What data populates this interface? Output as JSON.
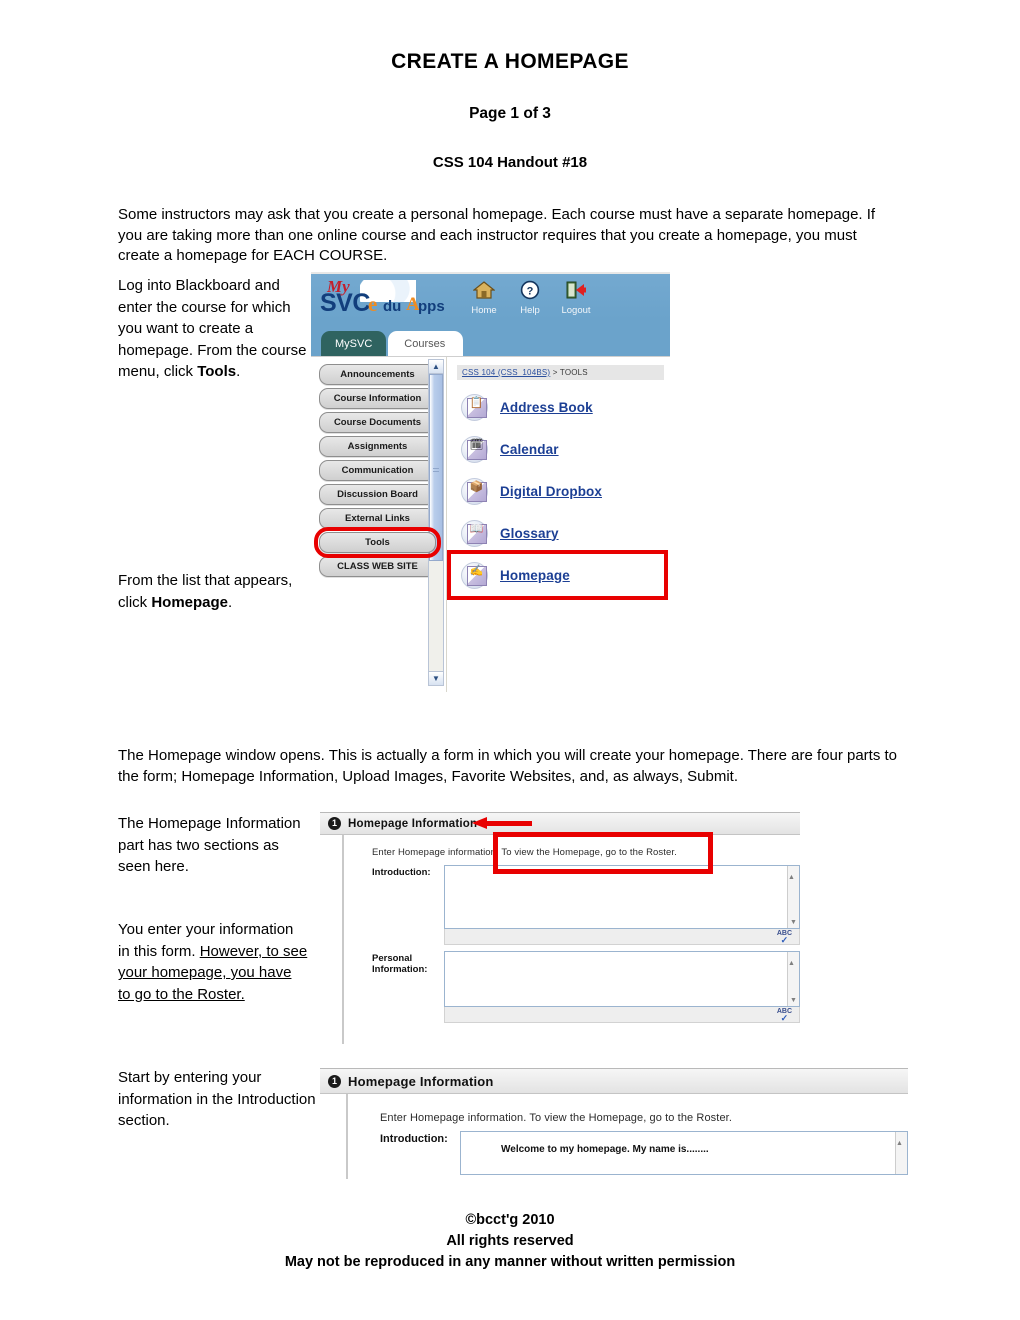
{
  "document": {
    "title": "CREATE A HOMEPAGE",
    "page_label": "Page 1 of 3",
    "handout_label": "CSS 104 Handout #18",
    "intro_paragraph": "Some instructors may ask that you create a personal homepage. Each course must have a separate homepage. If you are taking more than one online course and each instructor requires that you create a homepage, you must create a homepage for EACH COURSE.",
    "step1_note_a": "Log into Blackboard and enter the course for which you want to create a homepage. From the course menu, click ",
    "step1_note_bold": "Tools",
    "step1_note_b": ".",
    "step2_note_a": "From the list that appears, click ",
    "step2_note_bold": "Homepage",
    "step2_note_b": ".",
    "form_paragraph": "The Homepage window opens. This is actually a form in which you will create your homepage. There are four parts to the form; Homepage Information, Upload Images, Favorite Websites, and, as always, Submit.",
    "step3_note_a": "The Homepage Information part has two sections as seen here.",
    "step3_note_b": "You enter your information in this form. ",
    "step3_note_underlined": "However, to see your homepage, you have to go to the Roster.",
    "step4_note": "Start by entering your information in the Introduction section."
  },
  "footer": {
    "line1": "©bcct'g 2010",
    "line2": "All rights reserved",
    "line3": "May not be reproduced in any manner without written permission"
  },
  "blackboard": {
    "logo": {
      "my": "My",
      "svc": "SVC",
      "e": "e",
      "du": "du",
      "a": "A",
      "pps": "pps"
    },
    "nav_icons": [
      {
        "name": "home-icon",
        "label": "Home"
      },
      {
        "name": "help-icon",
        "label": "Help"
      },
      {
        "name": "logout-icon",
        "label": "Logout"
      }
    ],
    "tabs": [
      {
        "label": "MySVC",
        "active": false
      },
      {
        "label": "Courses",
        "active": true
      }
    ],
    "course_menu": [
      "Announcements",
      "Course Information",
      "Course Documents",
      "Assignments",
      "Communication",
      "Discussion Board",
      "External Links",
      "Tools",
      "CLASS WEB SITE"
    ],
    "highlighted_menu_item": "Tools",
    "breadcrumb": {
      "course_link": "CSS 104 (CSS_104BS)",
      "separator": " > ",
      "current": "TOOLS"
    },
    "tools": [
      {
        "label": "Address Book",
        "icon": "address-book-icon",
        "glyph": "📋"
      },
      {
        "label": "Calendar",
        "icon": "calendar-icon",
        "glyph": "🗓"
      },
      {
        "label": "Digital Dropbox",
        "icon": "dropbox-icon",
        "glyph": "📦"
      },
      {
        "label": "Glossary",
        "icon": "glossary-icon",
        "glyph": "📖"
      },
      {
        "label": "Homepage",
        "icon": "homepage-icon",
        "glyph": "✍"
      }
    ],
    "highlighted_tool": "Homepage",
    "scrollbar": {
      "up_arrow": "▲",
      "down_arrow": "▼"
    }
  },
  "homepage_form_blank": {
    "section_number": "1",
    "section_title": "Homepage Information",
    "instruction": "Enter Homepage information. To view the Homepage, go to the Roster.",
    "fields": [
      {
        "label": "Introduction:",
        "value": ""
      },
      {
        "label": "Personal Information:",
        "value": ""
      }
    ],
    "spellcheck_label": "ABC",
    "scroll_up": "▲",
    "scroll_down": "▼"
  },
  "homepage_form_filled": {
    "section_number": "1",
    "section_title": "Homepage Information",
    "instruction": "Enter Homepage information. To view the Homepage, go to the Roster.",
    "field_label": "Introduction:",
    "field_value": "Welcome to my homepage. My name is........",
    "scroll_up": "▲"
  },
  "colors": {
    "highlight_red": "#e80000",
    "banner_blue": "#6ba3cb",
    "tab_teal": "#2f6360",
    "link_blue": "#1c3f94"
  }
}
